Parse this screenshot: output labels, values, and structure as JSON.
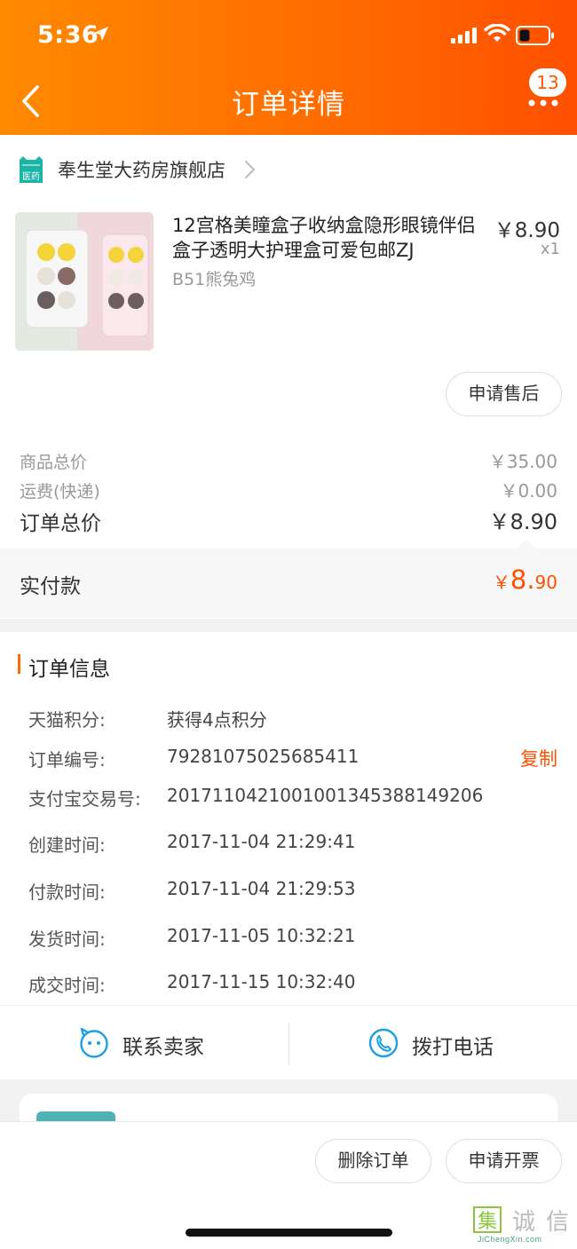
{
  "status_bar": {
    "time": "5:36"
  },
  "header": {
    "title": "订单详情",
    "badge_count": "13"
  },
  "store": {
    "icon_label": "医药",
    "name": "奉生堂大药房旗舰店"
  },
  "product": {
    "title": "12宫格美瞳盒子收纳盒隐形眼镜伴侣盒子透明大护理盒可爱包邮ZJ",
    "variant": "B51熊兔鸡",
    "price": "￥8.90",
    "quantity": "x1",
    "after_sales_label": "申请售后"
  },
  "summary": {
    "goods_total_label": "商品总价",
    "goods_total_value": "￥35.00",
    "shipping_label": "运费(快递)",
    "shipping_value": "￥0.00",
    "order_total_label": "订单总价",
    "order_total_value": "￥8.90",
    "paid_label": "实付款",
    "paid_currency": "￥",
    "paid_integer": "8.",
    "paid_decimal": "90"
  },
  "order_info": {
    "section_title": "订单信息",
    "copy_label": "复制",
    "rows": [
      {
        "label": "天猫积分:",
        "value": "获得4点积分"
      },
      {
        "label": "订单编号:",
        "value": "79281075025685411"
      },
      {
        "label": "支付宝交易号:",
        "value": "2017110421001001345388149206"
      },
      {
        "label": "创建时间:",
        "value": "2017-11-04 21:29:41"
      },
      {
        "label": "付款时间:",
        "value": "2017-11-04 21:29:53"
      },
      {
        "label": "发货时间:",
        "value": "2017-11-05 10:32:21"
      },
      {
        "label": "成交时间:",
        "value": "2017-11-15 10:32:40"
      }
    ]
  },
  "contact": {
    "seller_label": "联系卖家",
    "phone_label": "拨打电话"
  },
  "bottom_bar": {
    "delete_label": "删除订单",
    "invoice_label": "申请开票"
  },
  "watermark": {
    "text": "集诚信",
    "subtext": "JiChengXin.com"
  },
  "colors": {
    "accent": "#ff5000",
    "header_start": "#ff8a00",
    "header_end": "#ff4f00",
    "icon_blue": "#1aa0e6",
    "store_icon": "#1bb5a6"
  }
}
